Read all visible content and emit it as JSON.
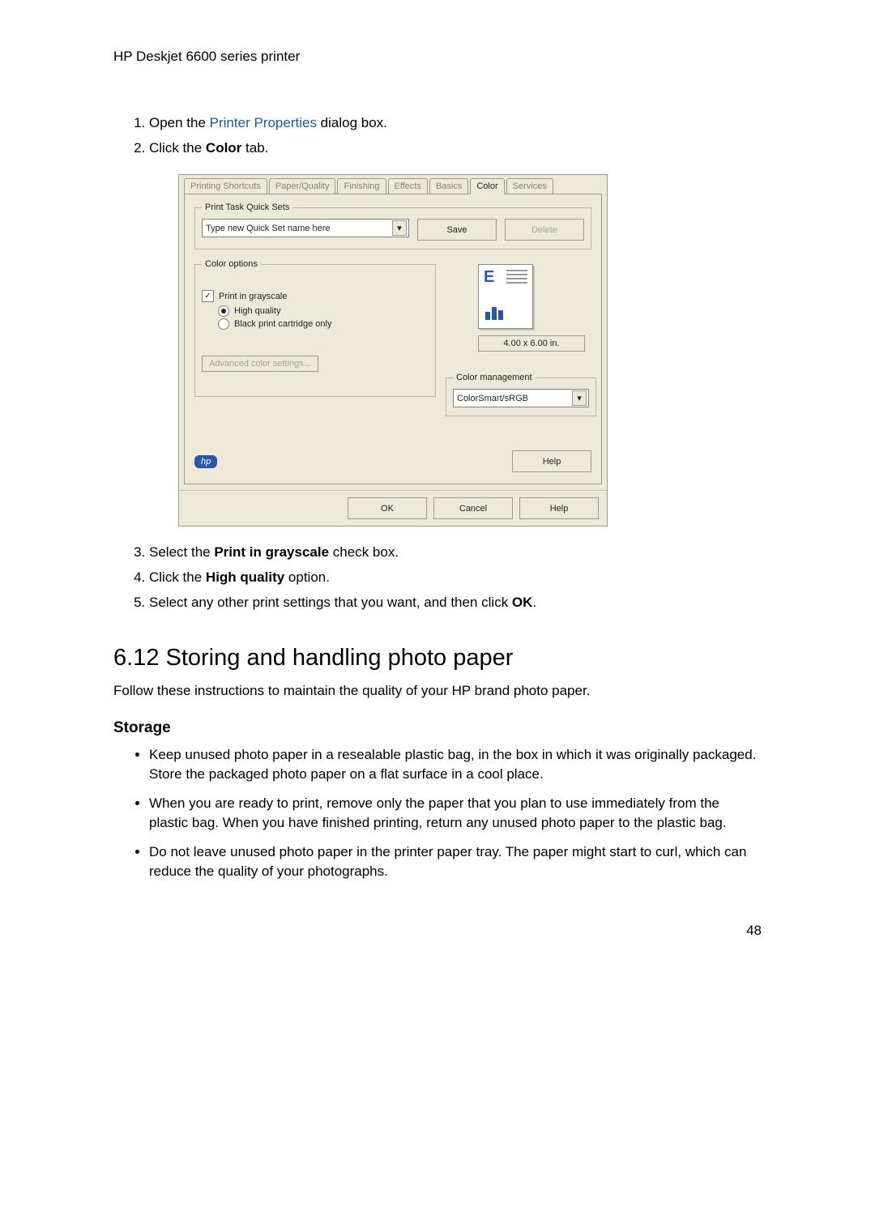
{
  "header": "HP Deskjet 6600 series printer",
  "steps_top": [
    {
      "pre": "Open the ",
      "link": "Printer Properties",
      "post": " dialog box."
    },
    {
      "pre": "Click the ",
      "bold": "Color",
      "post": " tab."
    }
  ],
  "dialog": {
    "tabs": [
      "Printing Shortcuts",
      "Paper/Quality",
      "Finishing",
      "Effects",
      "Basics",
      "Color",
      "Services"
    ],
    "active_tab": 5,
    "quickset_legend": "Print Task Quick Sets",
    "quickset_value": "Type new Quick Set name here",
    "save": "Save",
    "delete": "Delete",
    "coloropts_legend": "Color options",
    "grayscale": "Print in grayscale",
    "hq": "High quality",
    "blackonly": "Black print cartridge only",
    "adv": "Advanced color settings...",
    "dim": "4.00 x 6.00 in.",
    "mgmt_legend": "Color management",
    "mgmt_value": "ColorSmart/sRGB",
    "hp": "hp",
    "help": "Help",
    "ok": "OK",
    "cancel": "Cancel"
  },
  "steps_bottom": [
    {
      "pre": "Select the ",
      "bold": "Print in grayscale",
      "post": " check box."
    },
    {
      "pre": "Click the ",
      "bold": "High quality",
      "post": " option."
    },
    {
      "pre": "Select any other print settings that you want, and then click ",
      "bold": "OK",
      "post": "."
    }
  ],
  "section_title": "6.12  Storing and handling photo paper",
  "section_intro": "Follow these instructions to maintain the quality of your HP brand photo paper.",
  "sub_title": "Storage",
  "bullets": [
    "Keep unused photo paper in a resealable plastic bag, in the box in which it was originally packaged. Store the packaged photo paper on a flat surface in a cool place.",
    "When you are ready to print, remove only the paper that you plan to use immediately from the plastic bag. When you have finished printing, return any unused photo paper to the plastic bag.",
    "Do not leave unused photo paper in the printer paper tray. The paper might start to curl, which can reduce the quality of your photographs."
  ],
  "page_number": "48"
}
